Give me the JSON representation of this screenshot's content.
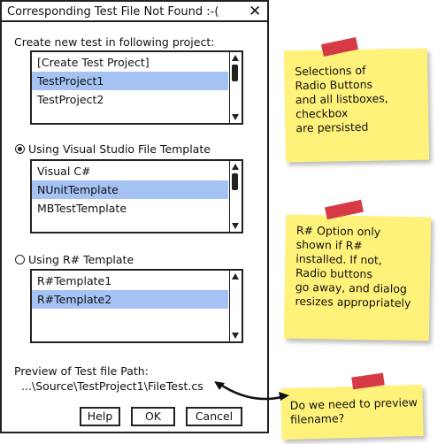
{
  "dialog": {
    "title": "Corresponding Test File Not Found  :-(",
    "close_glyph": "✕",
    "project_label": "Create new test in following project:",
    "projects": [
      {
        "label": "[Create Test Project]",
        "selected": false
      },
      {
        "label": "TestProject1",
        "selected": true
      },
      {
        "label": "TestProject2",
        "selected": false
      }
    ],
    "vs_radio_label": "Using Visual Studio File Template",
    "vs_radio_checked": true,
    "vs_templates": [
      {
        "label": "Visual C#",
        "selected": false
      },
      {
        "label": "NUnitTemplate",
        "selected": true
      },
      {
        "label": "MBTestTemplate",
        "selected": false
      }
    ],
    "rs_radio_label": "Using R# Template",
    "rs_radio_checked": false,
    "rs_templates": [
      {
        "label": "R#Template1",
        "selected": false
      },
      {
        "label": "R#Template2",
        "selected": true
      }
    ],
    "preview_label": "Preview of Test file Path:",
    "preview_path": "...\\Source\\TestProject1\\FileTest.cs",
    "buttons": {
      "help": "Help",
      "ok": "OK",
      "cancel": "Cancel"
    }
  },
  "notes": [
    {
      "lines": [
        "Selections of",
        "Radio Buttons",
        "and all listboxes,",
        "checkbox",
        "are persisted"
      ]
    },
    {
      "lines": [
        "R# Option only",
        "shown if R#",
        "installed. If not,",
        "Radio buttons",
        "go away, and dialog",
        "resizes appropriately"
      ]
    },
    {
      "lines": [
        "Do we need to preview",
        "filename?"
      ]
    }
  ],
  "colors": {
    "selection": "#a4c2f4",
    "sticky_note": "#fff27a",
    "tape": "#d63b45"
  }
}
